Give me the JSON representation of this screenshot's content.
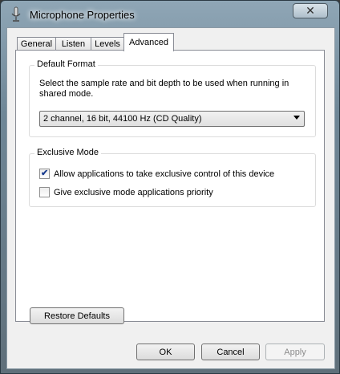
{
  "window": {
    "title": "Microphone Properties",
    "close_glyph": "✕"
  },
  "tabs": [
    {
      "label": "General"
    },
    {
      "label": "Listen"
    },
    {
      "label": "Levels"
    },
    {
      "label": "Advanced",
      "active": true
    }
  ],
  "default_format": {
    "group_label": "Default Format",
    "description": "Select the sample rate and bit depth to be used when running in shared mode.",
    "selected_value": "2 channel, 16 bit, 44100 Hz (CD Quality)"
  },
  "exclusive_mode": {
    "group_label": "Exclusive Mode",
    "options": [
      {
        "label": "Allow applications to take exclusive control of this device",
        "checked": true
      },
      {
        "label": "Give exclusive mode applications priority",
        "checked": false
      }
    ]
  },
  "buttons": {
    "restore_defaults": "Restore Defaults",
    "ok": "OK",
    "cancel": "Cancel",
    "apply": "Apply"
  },
  "colors": {
    "checkmark": "#1a3d8f",
    "disabled_text": "#8c8c8c"
  }
}
